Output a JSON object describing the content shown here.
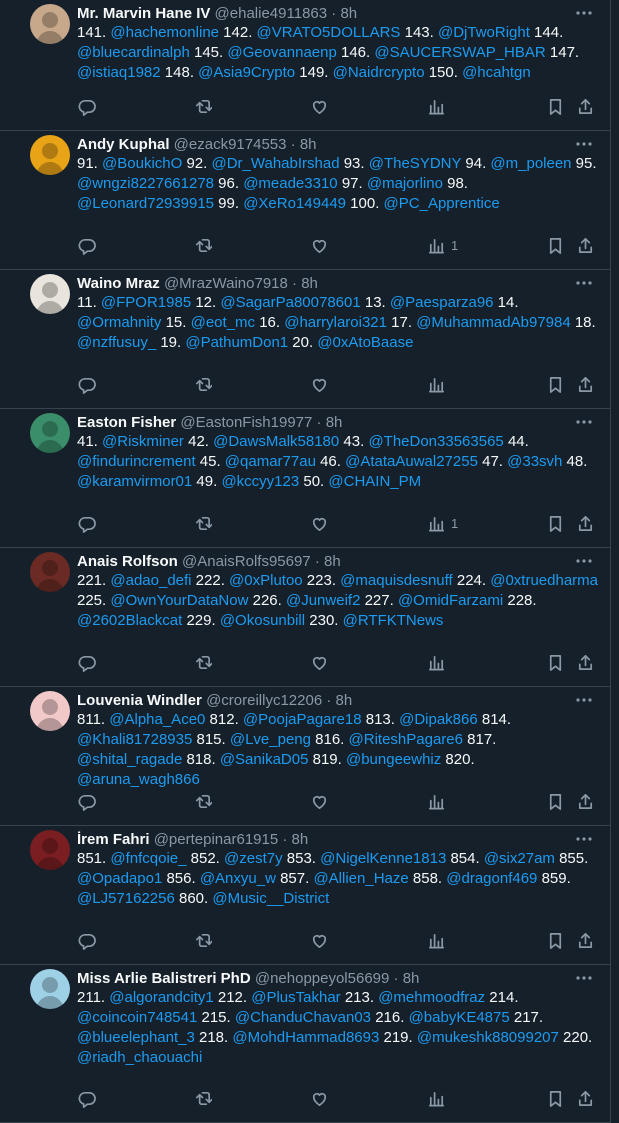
{
  "tweets": [
    {
      "name": "Mr. Marvin Hane IV",
      "handle": "@ehalie4911863",
      "time": "8h",
      "avatar_color": "#c7a88b",
      "segments": [
        {
          "t": "141. "
        },
        {
          "t": "@hachemonline",
          "m": true
        },
        {
          "t": " 142. "
        },
        {
          "t": "@VRATO5DOLLARS",
          "m": true
        },
        {
          "t": " 143. "
        },
        {
          "t": "@DjTwoRight",
          "m": true
        },
        {
          "t": " 144. "
        },
        {
          "t": "@bluecardinalph",
          "m": true
        },
        {
          "t": " 145. "
        },
        {
          "t": "@Geovannaenp",
          "m": true
        },
        {
          "t": " 146. "
        },
        {
          "t": "@SAUCERSWAP_HBAR",
          "m": true
        },
        {
          "t": " 147. "
        },
        {
          "t": "@istiaq1982",
          "m": true
        },
        {
          "t": " 148. "
        },
        {
          "t": "@Asia9Crypto",
          "m": true
        },
        {
          "t": " 149. "
        },
        {
          "t": "@Naidrcrypto",
          "m": true
        },
        {
          "t": " 150. "
        },
        {
          "t": "@hcahtgn",
          "m": true
        }
      ],
      "views": ""
    },
    {
      "name": "Andy Kuphal",
      "handle": "@ezack9174553",
      "time": "8h",
      "avatar_color": "#e8a317",
      "segments": [
        {
          "t": "91. "
        },
        {
          "t": "@BoukichO",
          "m": true
        },
        {
          "t": " 92. "
        },
        {
          "t": "@Dr_WahabIrshad",
          "m": true
        },
        {
          "t": " 93. "
        },
        {
          "t": "@TheSYDNY",
          "m": true
        },
        {
          "t": " 94. "
        },
        {
          "t": "@m_poleen",
          "m": true
        },
        {
          "t": " 95. "
        },
        {
          "t": "@wngzi8227661278",
          "m": true
        },
        {
          "t": " 96. "
        },
        {
          "t": "@meade3310",
          "m": true
        },
        {
          "t": " 97. "
        },
        {
          "t": "@majorlino",
          "m": true
        },
        {
          "t": " 98. "
        },
        {
          "t": "@Leonard72939915",
          "m": true
        },
        {
          "t": " 99. "
        },
        {
          "t": "@XeRo149449",
          "m": true
        },
        {
          "t": " 100. "
        },
        {
          "t": "@PC_Apprentice",
          "m": true
        }
      ],
      "views": "1"
    },
    {
      "name": "Waino Mraz",
      "handle": "@MrazWaino7918",
      "time": "8h",
      "avatar_color": "#e9e4dc",
      "segments": [
        {
          "t": "11. "
        },
        {
          "t": "@FPOR1985",
          "m": true
        },
        {
          "t": " 12. "
        },
        {
          "t": "@SagarPa80078601",
          "m": true
        },
        {
          "t": " 13. "
        },
        {
          "t": "@Paesparza96",
          "m": true
        },
        {
          "t": " 14. "
        },
        {
          "t": "@Ormahnity",
          "m": true
        },
        {
          "t": " 15. "
        },
        {
          "t": "@eot_mc",
          "m": true
        },
        {
          "t": " 16. "
        },
        {
          "t": "@harrylaroi321",
          "m": true
        },
        {
          "t": " 17. "
        },
        {
          "t": "@MuhammadAb97984",
          "m": true
        },
        {
          "t": " 18. "
        },
        {
          "t": "@nzffusuy_",
          "m": true
        },
        {
          "t": " 19. "
        },
        {
          "t": "@PathumDon1",
          "m": true
        },
        {
          "t": " 20. "
        },
        {
          "t": "@0xAtoBaase",
          "m": true
        }
      ],
      "views": ""
    },
    {
      "name": "Easton Fisher",
      "handle": "@EastonFish19977",
      "time": "8h",
      "avatar_color": "#3a8f6a",
      "segments": [
        {
          "t": "41. "
        },
        {
          "t": "@Riskminer",
          "m": true
        },
        {
          "t": " 42. "
        },
        {
          "t": "@DawsMalk58180",
          "m": true
        },
        {
          "t": " 43. "
        },
        {
          "t": "@TheDon33563565",
          "m": true
        },
        {
          "t": " 44. "
        },
        {
          "t": "@findurincrement",
          "m": true
        },
        {
          "t": " 45. "
        },
        {
          "t": "@qamar77au",
          "m": true
        },
        {
          "t": " 46. "
        },
        {
          "t": "@AtataAuwal27255",
          "m": true
        },
        {
          "t": " 47. "
        },
        {
          "t": "@33svh",
          "m": true
        },
        {
          "t": " 48. "
        },
        {
          "t": "@karamvirmor01",
          "m": true
        },
        {
          "t": " 49. "
        },
        {
          "t": "@kccyy123",
          "m": true
        },
        {
          "t": " 50. "
        },
        {
          "t": "@CHAIN_PM",
          "m": true
        }
      ],
      "views": "1"
    },
    {
      "name": "Anais Rolfson",
      "handle": "@AnaisRolfs95697",
      "time": "8h",
      "avatar_color": "#6b2b24",
      "segments": [
        {
          "t": "221. "
        },
        {
          "t": "@adao_defi",
          "m": true
        },
        {
          "t": " 222. "
        },
        {
          "t": "@0xPlutoo",
          "m": true
        },
        {
          "t": " 223. "
        },
        {
          "t": "@maquisdesnuff",
          "m": true
        },
        {
          "t": " 224. "
        },
        {
          "t": "@0xtruedharma",
          "m": true
        },
        {
          "t": " 225. "
        },
        {
          "t": "@OwnYourDataNow",
          "m": true
        },
        {
          "t": " 226. "
        },
        {
          "t": "@Junweif2",
          "m": true
        },
        {
          "t": " 227. "
        },
        {
          "t": "@OmidFarzami",
          "m": true
        },
        {
          "t": " 228. "
        },
        {
          "t": "@2602Blackcat",
          "m": true
        },
        {
          "t": " 229. "
        },
        {
          "t": "@Okosunbill",
          "m": true
        },
        {
          "t": " 230. "
        },
        {
          "t": "@RTFKTNews",
          "m": true
        }
      ],
      "views": ""
    },
    {
      "name": "Louvenia Windler",
      "handle": "@croreillyc12206",
      "time": "8h",
      "avatar_color": "#f2c9c9",
      "segments": [
        {
          "t": "811. "
        },
        {
          "t": "@Alpha_Ace0",
          "m": true
        },
        {
          "t": " 812. "
        },
        {
          "t": "@PoojaPagare18",
          "m": true
        },
        {
          "t": " 813. "
        },
        {
          "t": "@Dipak866",
          "m": true
        },
        {
          "t": " 814. "
        },
        {
          "t": "@Khali81728935",
          "m": true
        },
        {
          "t": " 815. "
        },
        {
          "t": "@Lve_peng",
          "m": true
        },
        {
          "t": " 816. "
        },
        {
          "t": "@RiteshPagare6",
          "m": true
        },
        {
          "t": " 817. "
        },
        {
          "t": "@shital_ragade",
          "m": true
        },
        {
          "t": " 818. "
        },
        {
          "t": "@SanikaD05",
          "m": true
        },
        {
          "t": " 819. "
        },
        {
          "t": "@bungeewhiz",
          "m": true
        },
        {
          "t": " 820. "
        },
        {
          "t": "@aruna_wagh866",
          "m": true
        }
      ],
      "views": ""
    },
    {
      "name": "İrem Fahri",
      "handle": "@pertepinar61915",
      "time": "8h",
      "avatar_color": "#7a1e22",
      "segments": [
        {
          "t": "851. "
        },
        {
          "t": "@fnfcqoie_",
          "m": true
        },
        {
          "t": " 852. "
        },
        {
          "t": "@zest7y",
          "m": true
        },
        {
          "t": " 853. "
        },
        {
          "t": "@NigelKenne1813",
          "m": true
        },
        {
          "t": " 854. "
        },
        {
          "t": "@six27am",
          "m": true
        },
        {
          "t": " 855. "
        },
        {
          "t": "@Opadapo1",
          "m": true
        },
        {
          "t": " 856. "
        },
        {
          "t": "@Anxyu_w",
          "m": true
        },
        {
          "t": " 857. "
        },
        {
          "t": "@Allien_Haze",
          "m": true
        },
        {
          "t": " 858. "
        },
        {
          "t": "@dragonf469",
          "m": true
        },
        {
          "t": " 859. "
        },
        {
          "t": "@LJ57162256",
          "m": true
        },
        {
          "t": " 860. "
        },
        {
          "t": "@Music__District",
          "m": true
        }
      ],
      "views": ""
    },
    {
      "name": "Miss Arlie Balistreri PhD",
      "handle": "@nehoppeyol56699",
      "time": "8h",
      "avatar_color": "#9fd1e6",
      "segments": [
        {
          "t": "211. "
        },
        {
          "t": "@algorandcity1",
          "m": true
        },
        {
          "t": " 212. "
        },
        {
          "t": "@PlusTakhar",
          "m": true
        },
        {
          "t": " 213. "
        },
        {
          "t": "@mehmoodfraz",
          "m": true
        },
        {
          "t": " 214. "
        },
        {
          "t": "@coincoin748541",
          "m": true
        },
        {
          "t": " 215. "
        },
        {
          "t": "@ChanduChavan03",
          "m": true
        },
        {
          "t": " 216. "
        },
        {
          "t": "@babyKE4875",
          "m": true
        },
        {
          "t": " 217. "
        },
        {
          "t": "@blueelephant_3",
          "m": true
        },
        {
          "t": " 218. "
        },
        {
          "t": "@MohdHammad8693",
          "m": true
        },
        {
          "t": " 219. "
        },
        {
          "t": "@mukeshk88099207",
          "m": true
        },
        {
          "t": " 220. "
        },
        {
          "t": "@riadh_chaouachi",
          "m": true
        }
      ],
      "views": ""
    }
  ],
  "dot": "·",
  "colors": {
    "bg": "#15202b",
    "mention": "#1d9bf0",
    "muted": "#8b98a5",
    "divider": "#38444d"
  }
}
